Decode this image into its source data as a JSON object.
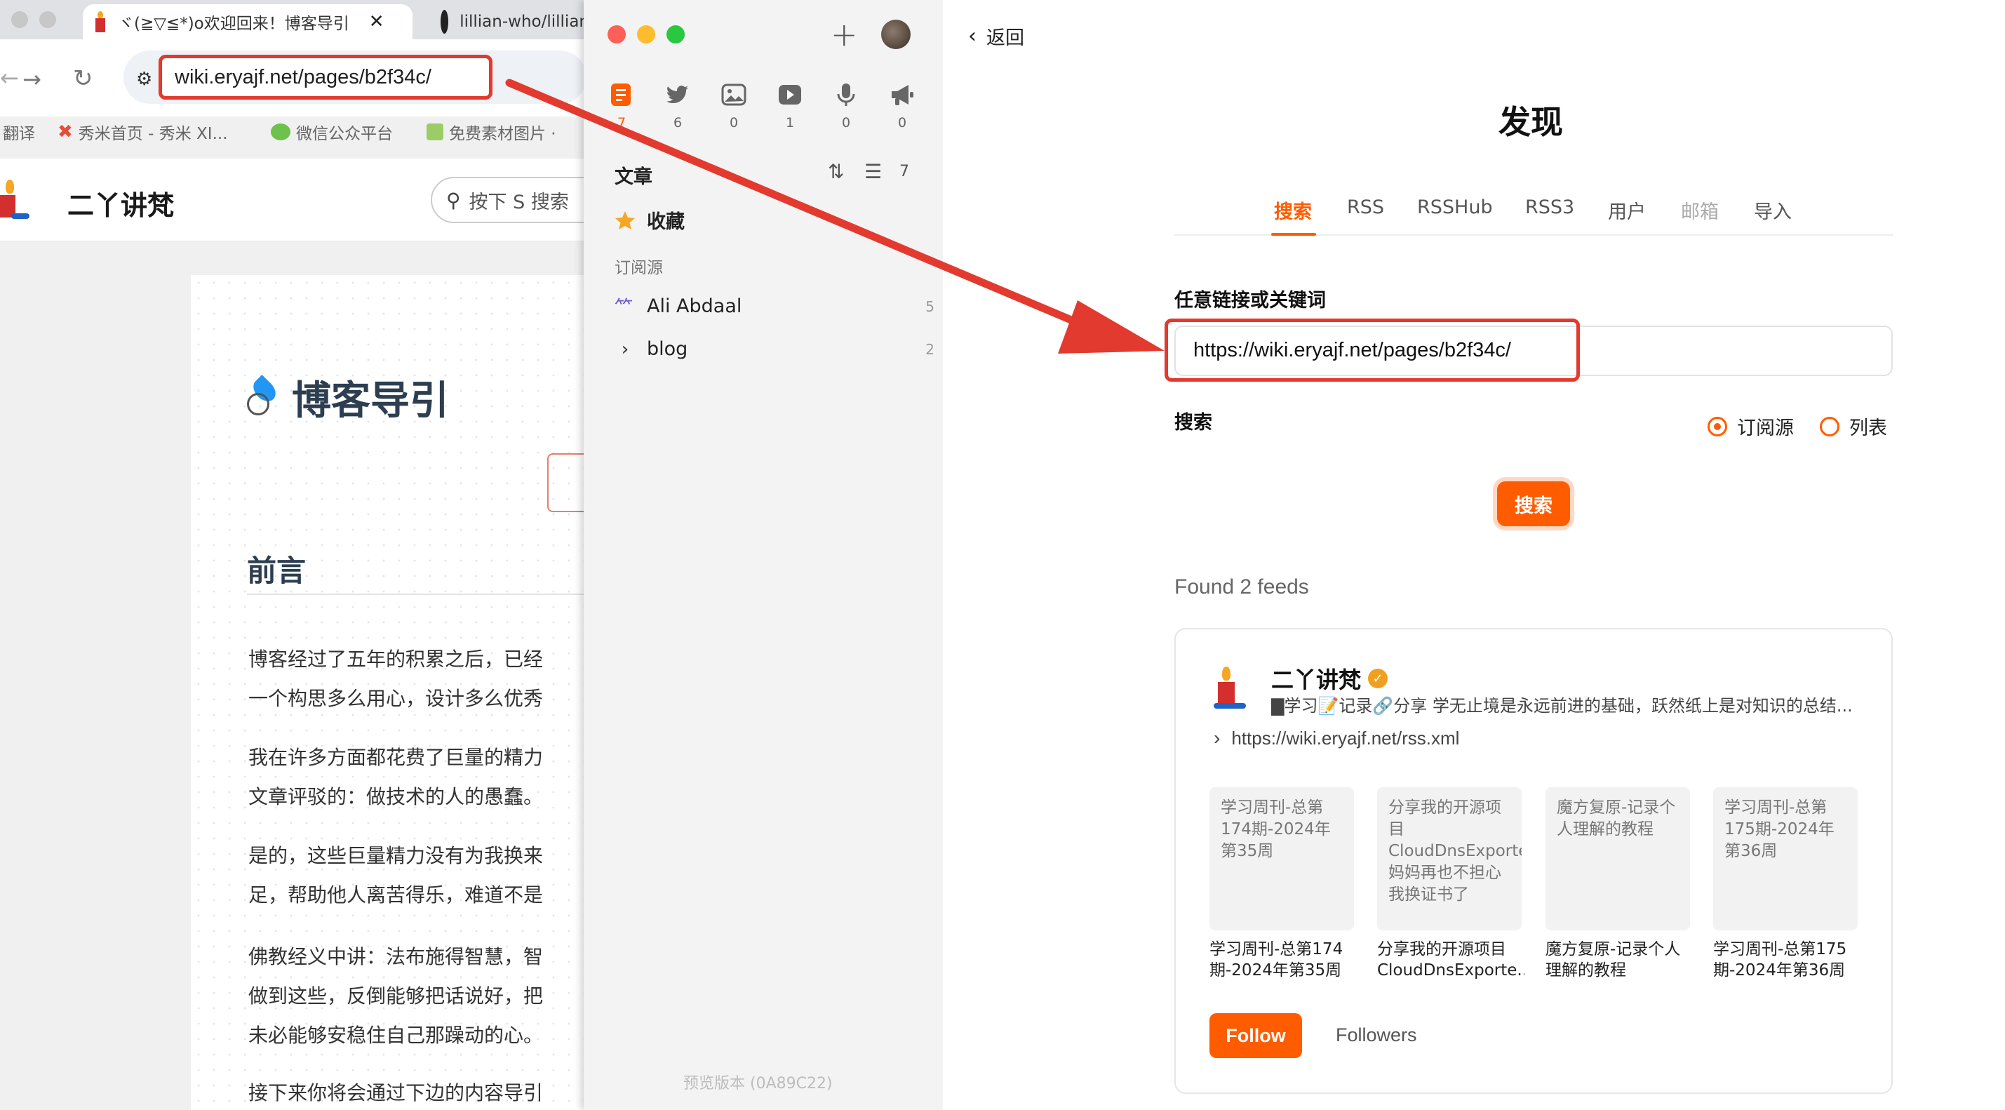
{
  "browser": {
    "tabs": [
      {
        "title": "ヾ(≧▽≦*)o欢迎回来！博客导引"
      },
      {
        "title": "lillian-who/lillian"
      }
    ],
    "url": "wiki.eryajf.net/pages/b2f34c/",
    "bookmarks": [
      "翻译",
      "秀米首页 - 秀米 XI...",
      "微信公众平台",
      "免费素材图片 ·"
    ],
    "site_name": "二丫讲梵",
    "search_placeholder": "按下 S 搜索",
    "page_title": "博客导引",
    "section_heading": "前言",
    "paragraphs": [
      [
        "博客经过了五年的积累之后，已经",
        "一个构思多么用心，设计多么优秀"
      ],
      [
        "我在许多方面都花费了巨量的精力",
        "文章评驳的：做技术的人的愚蠢。"
      ],
      [
        "是的，这些巨量精力没有为我换来",
        "足，帮助他人离苦得乐，难道不是"
      ],
      [
        "佛教经义中讲：法布施得智慧，智",
        "做到这些，反倒能够把话说好，把",
        "未必能够安稳住自己那躁动的心。"
      ],
      [
        "接下来你将会通过下边的内容导引"
      ]
    ]
  },
  "reader": {
    "categories": [
      {
        "icon": "article-icon",
        "count": "7"
      },
      {
        "icon": "twitter-icon",
        "count": "6"
      },
      {
        "icon": "image-icon",
        "count": "0"
      },
      {
        "icon": "video-icon",
        "count": "1"
      },
      {
        "icon": "microphone-icon",
        "count": "0"
      },
      {
        "icon": "megaphone-icon",
        "count": "0"
      }
    ],
    "section_label": "文章",
    "section_count": "7",
    "favorites_label": "收藏",
    "subscriptions_label": "订阅源",
    "subscriptions": [
      {
        "name": "Ali Abdaal",
        "count": "5"
      },
      {
        "name": "blog",
        "count": "2"
      }
    ],
    "version": "预览版本 (0A89C22)"
  },
  "discover": {
    "back_label": "返回",
    "title": "发现",
    "tabs": [
      "搜索",
      "RSS",
      "RSSHub",
      "RSS3",
      "用户",
      "邮箱",
      "导入"
    ],
    "active_tab": "搜索",
    "input_label": "任意链接或关键词",
    "input_value": "https://wiki.eryajf.net/pages/b2f34c/",
    "search_label": "搜索",
    "radio_options": [
      "订阅源",
      "列表"
    ],
    "radio_selected": "订阅源",
    "search_button": "搜索",
    "found_text": "Found 2 feeds",
    "feed": {
      "name": "二丫讲梵",
      "description": "▇学习📝记录🔗分享 学无止境是永远前进的基础，跃然纸上是对知识的总结...",
      "url": "https://wiki.eryajf.net/rss.xml",
      "entries": [
        {
          "thumb_text": "学习周刊-总第174期-2024年第35周",
          "title": "学习周刊-总第174期-2024年第35周"
        },
        {
          "thumb_text": "分享我的开源项目CloudDnsExporter妈妈再也不担心我换证书了",
          "title": "分享我的开源项目CloudDnsExporte..."
        },
        {
          "thumb_text": "魔方复原-记录个人理解的教程",
          "title": "魔方复原-记录个人理解的教程"
        },
        {
          "thumb_text": "学习周刊-总第175期-2024年第36周",
          "title": "学习周刊-总第175期-2024年第36周"
        }
      ],
      "follow_label": "Follow",
      "followers_label": "Followers"
    }
  },
  "colors": {
    "accent": "#ff5c00",
    "annotation_red": "#e23a2e"
  }
}
